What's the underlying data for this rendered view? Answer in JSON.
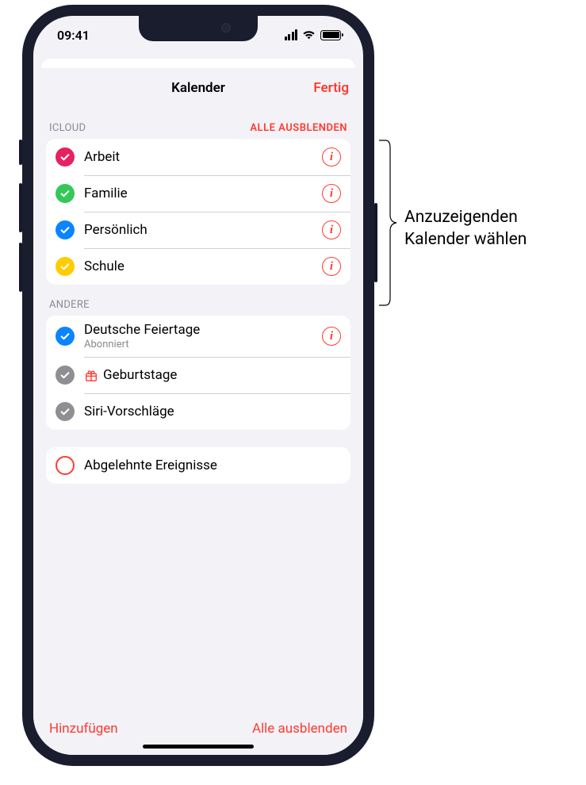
{
  "status": {
    "time": "09:41"
  },
  "sheet": {
    "title": "Kalender",
    "done": "Fertig"
  },
  "sections": {
    "icloud": {
      "header": "ICLOUD",
      "hideAll": "ALLE AUSBLENDEN",
      "items": [
        {
          "label": "Arbeit",
          "color": "#e6215f"
        },
        {
          "label": "Familie",
          "color": "#34c759"
        },
        {
          "label": "Persönlich",
          "color": "#0a84ff"
        },
        {
          "label": "Schule",
          "color": "#ffcc00"
        }
      ]
    },
    "other": {
      "header": "ANDERE",
      "items": [
        {
          "label": "Deutsche Feiertage",
          "sub": "Abonniert",
          "color": "#0a84ff",
          "info": true
        },
        {
          "label": "Geburtstage",
          "color": "#8e8e93",
          "icon": "gift"
        },
        {
          "label": "Siri-Vorschläge",
          "color": "#8e8e93"
        }
      ]
    },
    "declined": {
      "label": "Abgelehnte Ereignisse"
    }
  },
  "bottom": {
    "add": "Hinzufügen",
    "hideAll": "Alle ausblenden"
  },
  "callout": {
    "line1": "Anzuzeigenden",
    "line2": "Kalender wählen"
  }
}
